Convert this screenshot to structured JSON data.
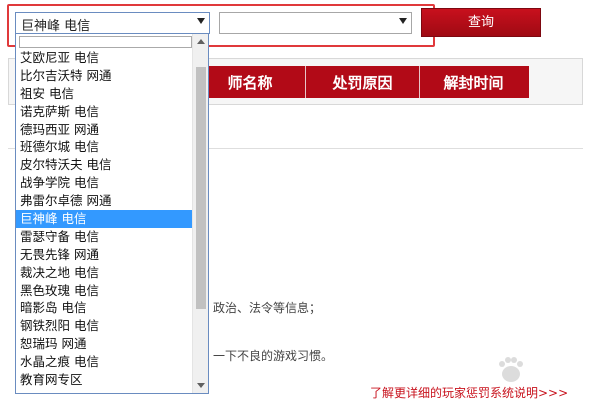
{
  "toolbar": {
    "server_select_value": "巨神峰 电信",
    "area_select_value": "",
    "search_label": "查询"
  },
  "table": {
    "headers": [
      "师名称",
      "处罚原因",
      "解封时间"
    ]
  },
  "background_fragments": {
    "policy_text": "政治、法令等信息；",
    "habit_text": "一下不良的游戏习惯。"
  },
  "link": {
    "label": "了解更详细的玩家惩罚系统说明>>>"
  },
  "dropdown": {
    "items": [
      {
        "label": "艾欧尼亚 电信",
        "selected": false
      },
      {
        "label": "比尔吉沃特 网通",
        "selected": false
      },
      {
        "label": "祖安 电信",
        "selected": false
      },
      {
        "label": "诺克萨斯 电信",
        "selected": false
      },
      {
        "label": "德玛西亚 网通",
        "selected": false
      },
      {
        "label": "班德尔城 电信",
        "selected": false
      },
      {
        "label": "皮尔特沃夫 电信",
        "selected": false
      },
      {
        "label": "战争学院 电信",
        "selected": false
      },
      {
        "label": "弗雷尔卓德 网通",
        "selected": false
      },
      {
        "label": "巨神峰 电信",
        "selected": true
      },
      {
        "label": "雷瑟守备 电信",
        "selected": false
      },
      {
        "label": "无畏先锋 网通",
        "selected": false
      },
      {
        "label": "裁决之地 电信",
        "selected": false
      },
      {
        "label": "黑色玫瑰 电信",
        "selected": false
      },
      {
        "label": "暗影岛 电信",
        "selected": false
      },
      {
        "label": "钢铁烈阳 电信",
        "selected": false
      },
      {
        "label": "恕瑞玛 网通",
        "selected": false
      },
      {
        "label": "水晶之痕 电信",
        "selected": false
      },
      {
        "label": "教育网专区",
        "selected": false
      }
    ]
  },
  "colors": {
    "brand_red": "#b20a17",
    "highlight_frame": "#e0393b",
    "selected_blue": "#3399ff"
  }
}
